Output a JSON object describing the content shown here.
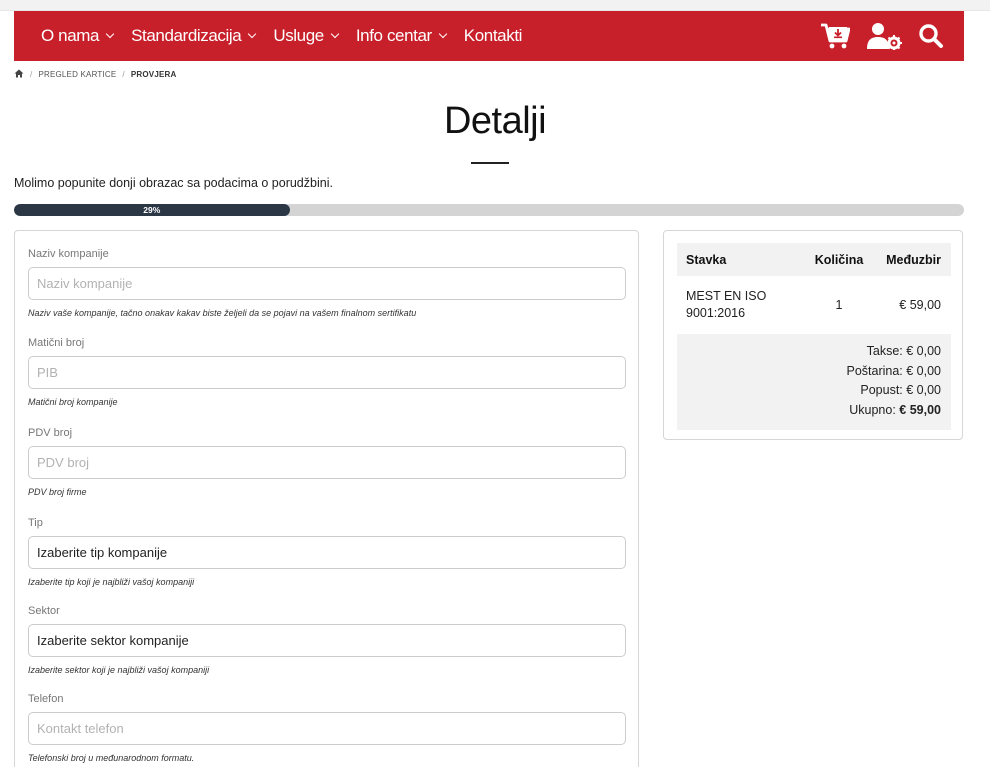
{
  "nav": {
    "items": [
      {
        "label": "O nama",
        "has_dropdown": true
      },
      {
        "label": "Standardizacija",
        "has_dropdown": true
      },
      {
        "label": "Usluge",
        "has_dropdown": true
      },
      {
        "label": "Info centar",
        "has_dropdown": true
      },
      {
        "label": "Kontakti",
        "has_dropdown": false
      }
    ],
    "icons": [
      "cart-download-icon",
      "user-settings-icon",
      "search-icon"
    ],
    "background_color": "#c8202b"
  },
  "breadcrumb": {
    "home_icon": "home-icon",
    "items": [
      "PREGLED KARTICE",
      "PROVJERA"
    ]
  },
  "page": {
    "title": "Detalji",
    "intro": "Molimo popunite donji obrazac sa podacima o porudžbini."
  },
  "progress": {
    "value": 0.29,
    "label": "29%",
    "fill_color": "#2c3746"
  },
  "form": {
    "fields": [
      {
        "label": "Naziv kompanije",
        "placeholder": "Naziv kompanije",
        "value": "",
        "help": "Naziv vaše kompanije, tačno onakav kakav biste željeli da se pojavi na vašem finalnom sertifikatu"
      },
      {
        "label": "Matični broj",
        "placeholder": "PIB",
        "value": "",
        "help": "Matični broj kompanije"
      },
      {
        "label": "PDV broj",
        "placeholder": "PDV broj",
        "value": "",
        "help": "PDV broj firme"
      },
      {
        "label": "Tip",
        "placeholder": "",
        "value": "Izaberite tip kompanije",
        "help": "Izaberite tip koji je najbliži vašoj kompaniji"
      },
      {
        "label": "Sektor",
        "placeholder": "",
        "value": "Izaberite sektor kompanije",
        "help": "Izaberite sektor koji je najbliži vašoj kompaniji"
      },
      {
        "label": "Telefon",
        "placeholder": "Kontakt telefon",
        "value": "",
        "help": "Telefonski broj u međunarodnom formatu."
      }
    ]
  },
  "cart": {
    "headers": {
      "item": "Stavka",
      "qty": "Količina",
      "subtotal": "Međuzbir"
    },
    "rows": [
      {
        "item": "MEST EN ISO 9001:2016",
        "qty": "1",
        "subtotal": "€ 59,00"
      }
    ],
    "totals": {
      "tax": "Takse: € 0,00",
      "shipping": "Poštarina: € 0,00",
      "discount": "Popust: € 0,00",
      "total_label": "Ukupno:",
      "total_value": "€ 59,00"
    }
  }
}
